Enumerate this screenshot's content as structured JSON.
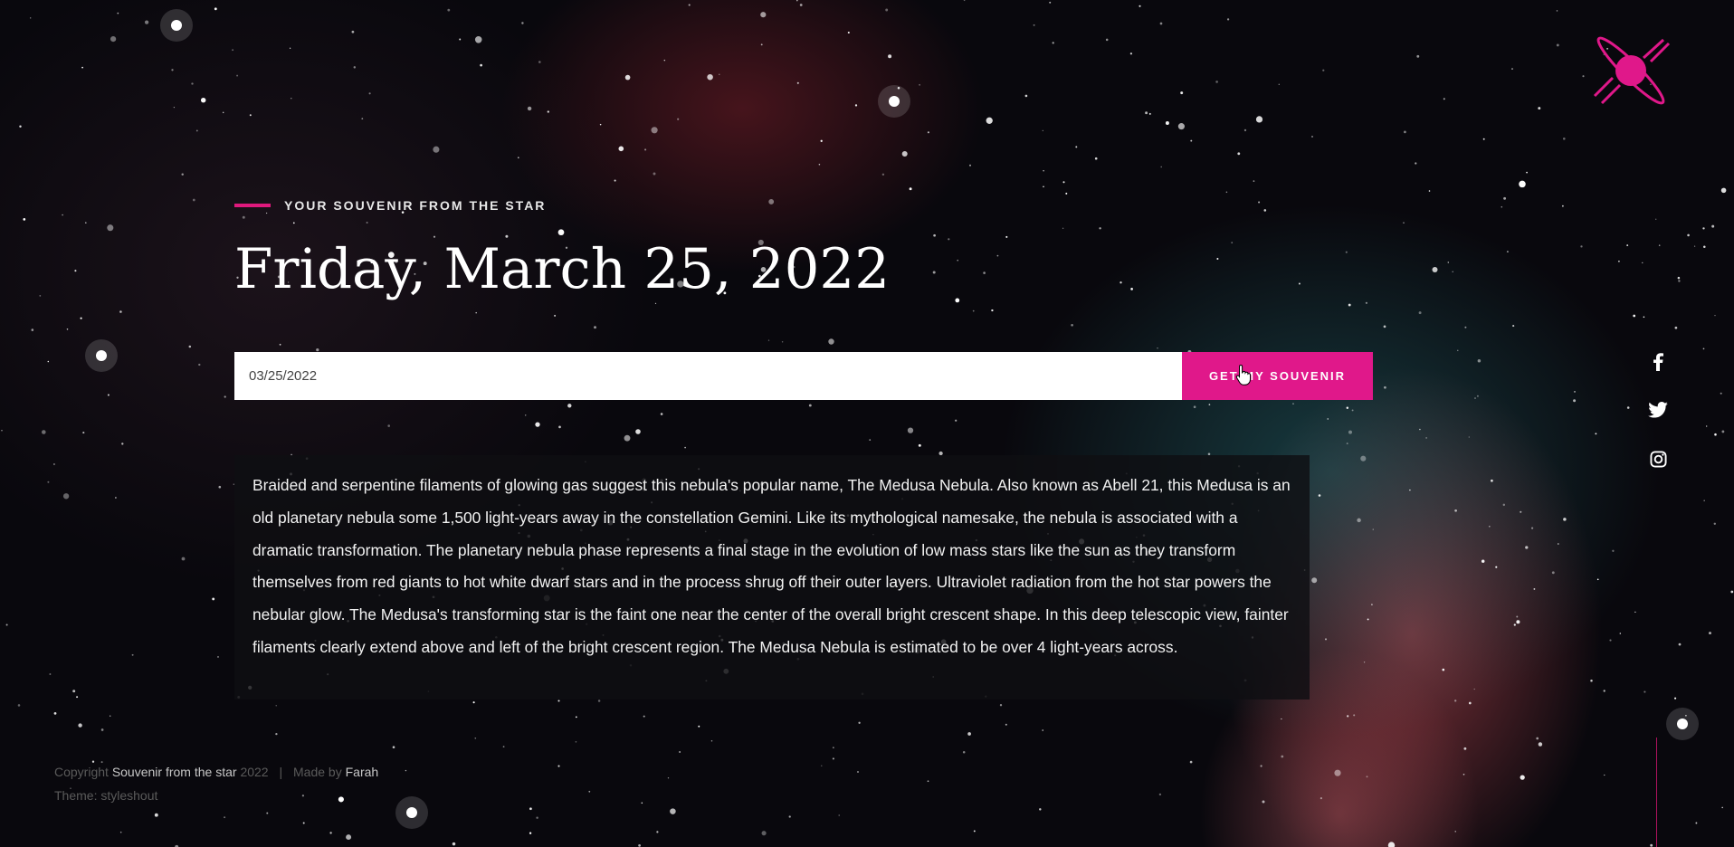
{
  "brand": {
    "logo_icon": "ringed-planet-icon",
    "accent_color": "#e0188a"
  },
  "hero": {
    "eyebrow": "YOUR SOUVENIR FROM THE STAR",
    "title": "Friday, March 25, 2022"
  },
  "form": {
    "date_value": "03/25/2022",
    "submit_label": "GET MY SOUVENIR"
  },
  "description": "Braided and serpentine filaments of glowing gas suggest this nebula's popular name, The Medusa Nebula. Also known as Abell 21, this Medusa is an old planetary nebula some 1,500 light-years away in the constellation Gemini. Like its mythological namesake, the nebula is associated with a dramatic transformation. The planetary nebula phase represents a final stage in the evolution of low mass stars like the sun as they transform themselves from red giants to hot white dwarf stars and in the process shrug off their outer layers. Ultraviolet radiation from the hot star powers the nebular glow. The Medusa's transforming star is the faint one near the center of the overall bright crescent shape. In this deep telescopic view, fainter filaments clearly extend above and left of the bright crescent region. The Medusa Nebula is estimated to be over 4 light-years across.",
  "social": [
    {
      "name": "facebook-icon"
    },
    {
      "name": "twitter-icon"
    },
    {
      "name": "instagram-icon"
    }
  ],
  "footer": {
    "copyright_prefix": "Copyright",
    "site_link": "Souvenir from the star",
    "year": "2022",
    "made_by_prefix": "Made by",
    "author_link": "Farah",
    "theme": "Theme: styleshout"
  }
}
